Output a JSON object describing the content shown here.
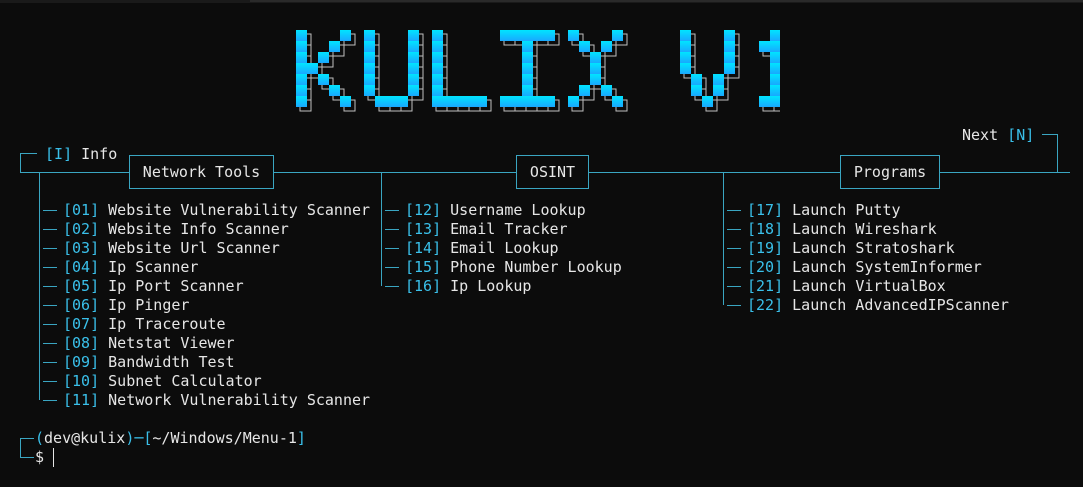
{
  "header": {
    "info_key": "I",
    "info_label": "Info",
    "next_label": "Next",
    "next_key": "N"
  },
  "logo": {
    "text": "KULIX V1",
    "color_start": "#00e5ff",
    "color_end": "#19a8ff"
  },
  "sections": [
    {
      "title": "Network Tools",
      "items": [
        {
          "num": "01",
          "label": "Website Vulnerability Scanner"
        },
        {
          "num": "02",
          "label": "Website Info Scanner"
        },
        {
          "num": "03",
          "label": "Website Url Scanner"
        },
        {
          "num": "04",
          "label": "Ip Scanner"
        },
        {
          "num": "05",
          "label": "Ip Port Scanner"
        },
        {
          "num": "06",
          "label": "Ip Pinger"
        },
        {
          "num": "07",
          "label": "Ip Traceroute"
        },
        {
          "num": "08",
          "label": "Netstat Viewer"
        },
        {
          "num": "09",
          "label": "Bandwidth Test"
        },
        {
          "num": "10",
          "label": "Subnet Calculator"
        },
        {
          "num": "11",
          "label": "Network Vulnerability Scanner"
        }
      ]
    },
    {
      "title": "OSINT",
      "items": [
        {
          "num": "12",
          "label": "Username Lookup"
        },
        {
          "num": "13",
          "label": "Email Tracker"
        },
        {
          "num": "14",
          "label": "Email Lookup"
        },
        {
          "num": "15",
          "label": "Phone Number Lookup"
        },
        {
          "num": "16",
          "label": "Ip Lookup"
        }
      ]
    },
    {
      "title": "Programs",
      "items": [
        {
          "num": "17",
          "label": "Launch Putty"
        },
        {
          "num": "18",
          "label": "Launch Wireshark"
        },
        {
          "num": "19",
          "label": "Launch Stratoshark"
        },
        {
          "num": "20",
          "label": "Launch SystemInformer"
        },
        {
          "num": "21",
          "label": "Launch VirtualBox"
        },
        {
          "num": "22",
          "label": "Launch AdvancedIPScanner"
        }
      ]
    }
  ],
  "prompt": {
    "user_host": "dev@kulix",
    "path": "~/Windows/Menu-1",
    "symbol": "$"
  },
  "colors": {
    "accent": "#3ac0ea",
    "line": "#3aa6c2",
    "background": "#0c0c0c",
    "text": "#e6e6e6"
  }
}
